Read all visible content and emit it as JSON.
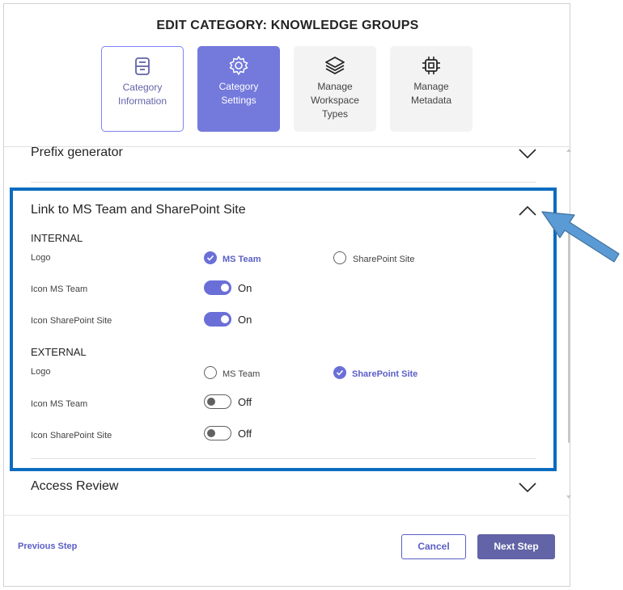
{
  "dialog": {
    "title": "EDIT CATEGORY: KNOWLEDGE GROUPS"
  },
  "steps": [
    {
      "label": "Category Information",
      "icon": "archive-icon",
      "state": "visited"
    },
    {
      "label": "Category Settings",
      "icon": "settings-gear-icon",
      "state": "active"
    },
    {
      "label": "Manage Workspace Types",
      "icon": "layers-icon",
      "state": "default"
    },
    {
      "label": "Manage Metadata",
      "icon": "chip-icon",
      "state": "default"
    }
  ],
  "sections": {
    "prefix": {
      "title": "Prefix generator",
      "expanded": false
    },
    "link": {
      "title": "Link to MS Team and SharePoint Site",
      "expanded": true,
      "internal": {
        "heading": "INTERNAL",
        "logo_label": "Logo",
        "logo_options": [
          "MS Team",
          "SharePoint Site"
        ],
        "logo_selected": "MS Team",
        "icon_ms_team_label": "Icon MS Team",
        "icon_ms_team_state": "On",
        "icon_sp_label": "Icon SharePoint Site",
        "icon_sp_state": "On"
      },
      "external": {
        "heading": "EXTERNAL",
        "logo_label": "Logo",
        "logo_options": [
          "MS Team",
          "SharePoint Site"
        ],
        "logo_selected": "SharePoint Site",
        "icon_ms_team_label": "Icon MS Team",
        "icon_ms_team_state": "Off",
        "icon_sp_label": "Icon SharePoint Site",
        "icon_sp_state": "Off"
      }
    },
    "access": {
      "title": "Access Review",
      "expanded": false
    }
  },
  "footer": {
    "previous_label": "Previous Step",
    "cancel_label": "Cancel",
    "next_label": "Next Step"
  },
  "colors": {
    "accent": "#6264a7",
    "active_tile": "#7479dc",
    "highlight_border": "#0b6cbf",
    "annotation_arrow": "#5b9bd5"
  }
}
